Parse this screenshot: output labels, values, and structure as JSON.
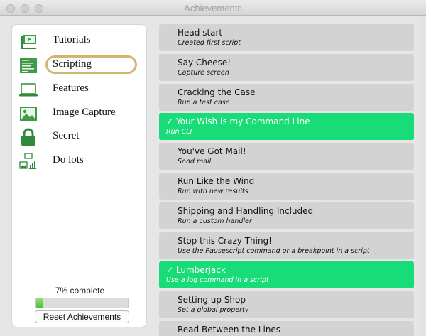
{
  "window": {
    "title": "Achievements"
  },
  "sidebar": {
    "items": [
      {
        "label": "Tutorials",
        "icon": "tutorial-icon"
      },
      {
        "label": "Scripting",
        "icon": "script-icon",
        "selected": true
      },
      {
        "label": "Features",
        "icon": "laptop-icon"
      },
      {
        "label": "Image Capture",
        "icon": "image-icon"
      },
      {
        "label": "Secret",
        "icon": "lock-icon"
      },
      {
        "label": "Do lots",
        "icon": "stats-icon"
      }
    ],
    "progress": {
      "label": "7% complete",
      "value": 0.07
    },
    "reset_label": "Reset Achievements"
  },
  "achievements": [
    {
      "title": "Head start",
      "subtitle": "Created first script",
      "done": false
    },
    {
      "title": "Say Cheese!",
      "subtitle": "Capture screen",
      "done": false
    },
    {
      "title": "Cracking the Case",
      "subtitle": "Run a test case",
      "done": false
    },
    {
      "title": "✓ Your Wish Is my Command Line",
      "subtitle": "Run CLI",
      "done": true
    },
    {
      "title": "You've Got Mail!",
      "subtitle": "Send mail",
      "done": false
    },
    {
      "title": "Run Like the Wind",
      "subtitle": "Run with new results",
      "done": false
    },
    {
      "title": "Shipping and Handling Included",
      "subtitle": "Run a custom handler",
      "done": false
    },
    {
      "title": "Stop this Crazy Thing!",
      "subtitle": "Use the Pausescript command or a breakpoint in a script",
      "done": false
    },
    {
      "title": "✓ Lumberjack",
      "subtitle": "Use a log command in a script",
      "done": true
    },
    {
      "title": "Setting up Shop",
      "subtitle": "Set a global property",
      "done": false
    },
    {
      "title": "Read Between the Lines",
      "subtitle": "",
      "done": false
    }
  ],
  "colors": {
    "done": "#18dc78",
    "pending": "#d3d3d3",
    "selection_ring": "#d2b56f"
  }
}
